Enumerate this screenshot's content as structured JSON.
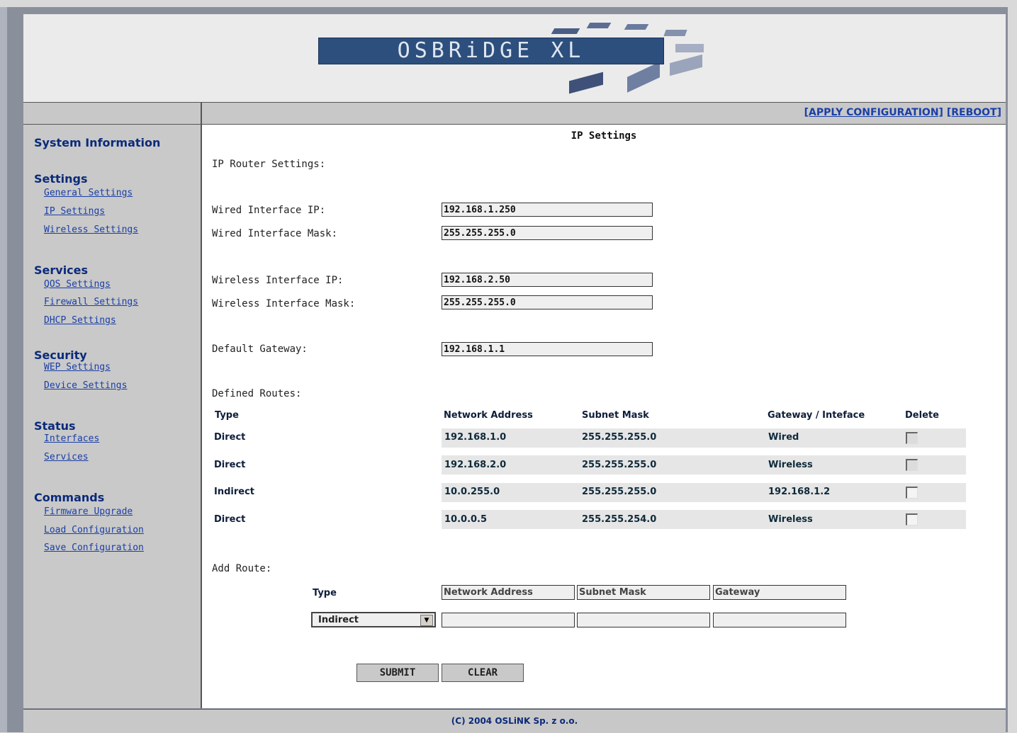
{
  "brand": {
    "logo_text": "OSBRiDGE XL"
  },
  "topbar": {
    "apply_label": "[APPLY CONFIGURATION]",
    "reboot_label": "[REBOOT]"
  },
  "sidebar": {
    "system_information": "System Information",
    "settings": {
      "title": "Settings",
      "items": [
        "General Settings",
        "IP Settings",
        "Wireless Settings"
      ]
    },
    "services": {
      "title": "Services",
      "items": [
        "QOS Settings",
        "Firewall Settings",
        "DHCP Settings"
      ]
    },
    "security": {
      "title": "Security",
      "items": [
        "WEP Settings",
        "Device Settings"
      ]
    },
    "status": {
      "title": "Status",
      "items": [
        "Interfaces",
        "Services"
      ]
    },
    "commands": {
      "title": "Commands",
      "items": [
        "Firmware Upgrade",
        "Load Configuration",
        "Save Configuration"
      ]
    }
  },
  "main": {
    "title": "IP Settings",
    "router_settings_label": "IP Router Settings:",
    "wired_ip_label": "Wired Interface IP:",
    "wired_ip_value": "192.168.1.250",
    "wired_mask_label": "Wired Interface Mask:",
    "wired_mask_value": "255.255.255.0",
    "wireless_ip_label": "Wireless Interface IP:",
    "wireless_ip_value": "192.168.2.50",
    "wireless_mask_label": "Wireless Interface Mask:",
    "wireless_mask_value": "255.255.255.0",
    "gateway_label": "Default Gateway:",
    "gateway_value": "192.168.1.1",
    "defined_routes_label": "Defined Routes:",
    "routes_headers": {
      "type": "Type",
      "network": "Network Address",
      "mask": "Subnet Mask",
      "gateway": "Gateway / Inteface",
      "delete": "Delete"
    },
    "routes": [
      {
        "type": "Direct",
        "network": "192.168.1.0",
        "mask": "255.255.255.0",
        "gateway": "Wired"
      },
      {
        "type": "Direct",
        "network": "192.168.2.0",
        "mask": "255.255.255.0",
        "gateway": "Wireless"
      },
      {
        "type": "Indirect",
        "network": "10.0.255.0",
        "mask": "255.255.255.0",
        "gateway": "192.168.1.2"
      },
      {
        "type": "Direct",
        "network": "10.0.0.5",
        "mask": "255.255.254.0",
        "gateway": "Wireless"
      }
    ],
    "add_route_label": "Add Route:",
    "add_route": {
      "type_label": "Type",
      "network_placeholder": "Network Address",
      "mask_placeholder": "Subnet Mask",
      "gateway_placeholder": "Gateway",
      "type_selected": "Indirect"
    },
    "submit_label": "SUBMIT",
    "clear_label": "CLEAR"
  },
  "footer": {
    "copyright": "(C) 2004 OSLiNK Sp. z o.o."
  }
}
